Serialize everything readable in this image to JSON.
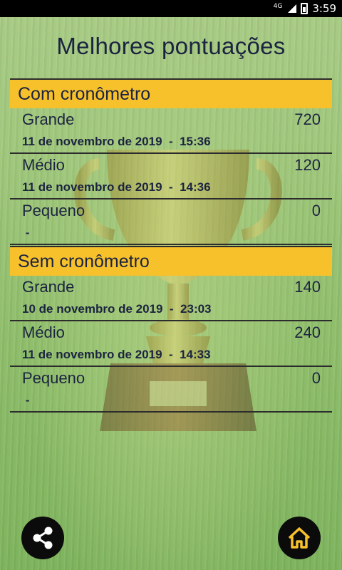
{
  "status_bar": {
    "network": "4G",
    "time": "3:59"
  },
  "title": "Melhores pontuações",
  "sections": [
    {
      "title": "Com cronômetro",
      "rows": [
        {
          "label": "Grande",
          "score": "720",
          "date": "11 de novembro de 2019  -  15:36"
        },
        {
          "label": "Médio",
          "score": "120",
          "date": "11 de novembro de 2019  -  14:36"
        },
        {
          "label": "Pequeno",
          "score": "0",
          "date": " -"
        }
      ]
    },
    {
      "title": "Sem cronômetro",
      "rows": [
        {
          "label": "Grande",
          "score": "140",
          "date": "10 de novembro de 2019  -  23:03"
        },
        {
          "label": "Médio",
          "score": "240",
          "date": "11 de novembro de 2019  -  14:33"
        },
        {
          "label": "Pequeno",
          "score": "0",
          "date": " -"
        }
      ]
    }
  ],
  "icons": {
    "share": "share-icon",
    "home": "home-icon",
    "background": "trophy-icon"
  },
  "colors": {
    "section_header": "#f7c12c",
    "text": "#1b2340",
    "fab": "#0b0b0b"
  }
}
